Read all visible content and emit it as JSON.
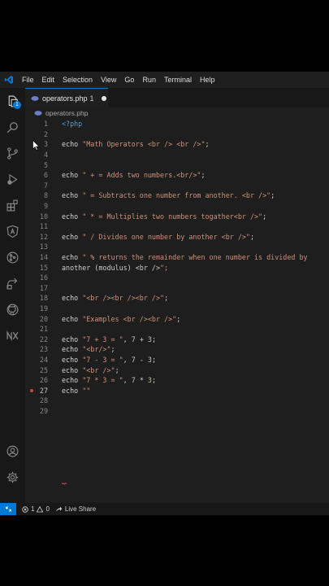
{
  "menu": [
    "File",
    "Edit",
    "Selection",
    "View",
    "Go",
    "Run",
    "Terminal",
    "Help"
  ],
  "activity_badge": "1",
  "tab": {
    "filename": "operators.php",
    "problems": "1"
  },
  "breadcrumb": "operators.php",
  "lines": [
    {
      "n": "1",
      "code": "<?php"
    },
    {
      "n": "2",
      "code": ""
    },
    {
      "n": "3",
      "code": "echo \"Math Operators <br /> <br />\";"
    },
    {
      "n": "4",
      "code": ""
    },
    {
      "n": "5",
      "code": ""
    },
    {
      "n": "6",
      "code": "echo \" + = Adds two numbers.<br/>\";"
    },
    {
      "n": "7",
      "code": ""
    },
    {
      "n": "8",
      "code": "echo \" = Subtracts one number from another. <br />\";"
    },
    {
      "n": "9",
      "code": ""
    },
    {
      "n": "10",
      "code": "echo \" * = Multiplies two numbers togather<br />\";"
    },
    {
      "n": "11",
      "code": ""
    },
    {
      "n": "12",
      "code": "echo \" / Divides one number by another <br />\";"
    },
    {
      "n": "13",
      "code": ""
    },
    {
      "n": "14",
      "code": "echo \" % returns the remainder when one number is divided by"
    },
    {
      "n": "15",
      "code": "another (modulus) <br />\";"
    },
    {
      "n": "16",
      "code": ""
    },
    {
      "n": "17",
      "code": ""
    },
    {
      "n": "18",
      "code": "echo \"<br /><br /><br />\";"
    },
    {
      "n": "19",
      "code": ""
    },
    {
      "n": "20",
      "code": "echo \"Examples <br /><br />\";"
    },
    {
      "n": "21",
      "code": ""
    },
    {
      "n": "22",
      "code": "echo \"7 + 3 = \", 7 + 3;"
    },
    {
      "n": "23",
      "code": "echo \"<br/>\";"
    },
    {
      "n": "24",
      "code": "echo \"7 - 3 = \", 7 - 3;"
    },
    {
      "n": "25",
      "code": "echo \"<br />\";"
    },
    {
      "n": "26",
      "code": "echo \"7 * 3 = \", 7 * 3;"
    },
    {
      "n": "27",
      "code": "echo \"\""
    },
    {
      "n": "28",
      "code": ""
    },
    {
      "n": "29",
      "code": ""
    }
  ],
  "status": {
    "errors": "1",
    "warnings": "0",
    "live_share": "Live Share"
  },
  "colors": {
    "accent": "#0078d4",
    "editor_bg": "#1e1e1e",
    "string": "#ce9178",
    "error": "#c74e39"
  },
  "icons": [
    "vscode-logo-icon",
    "explorer-icon",
    "search-icon",
    "source-control-icon",
    "run-debug-icon",
    "extensions-icon",
    "angular-icon",
    "git-icon",
    "remote-icon",
    "github-icon",
    "nx-icon",
    "account-icon",
    "settings-gear-icon"
  ]
}
